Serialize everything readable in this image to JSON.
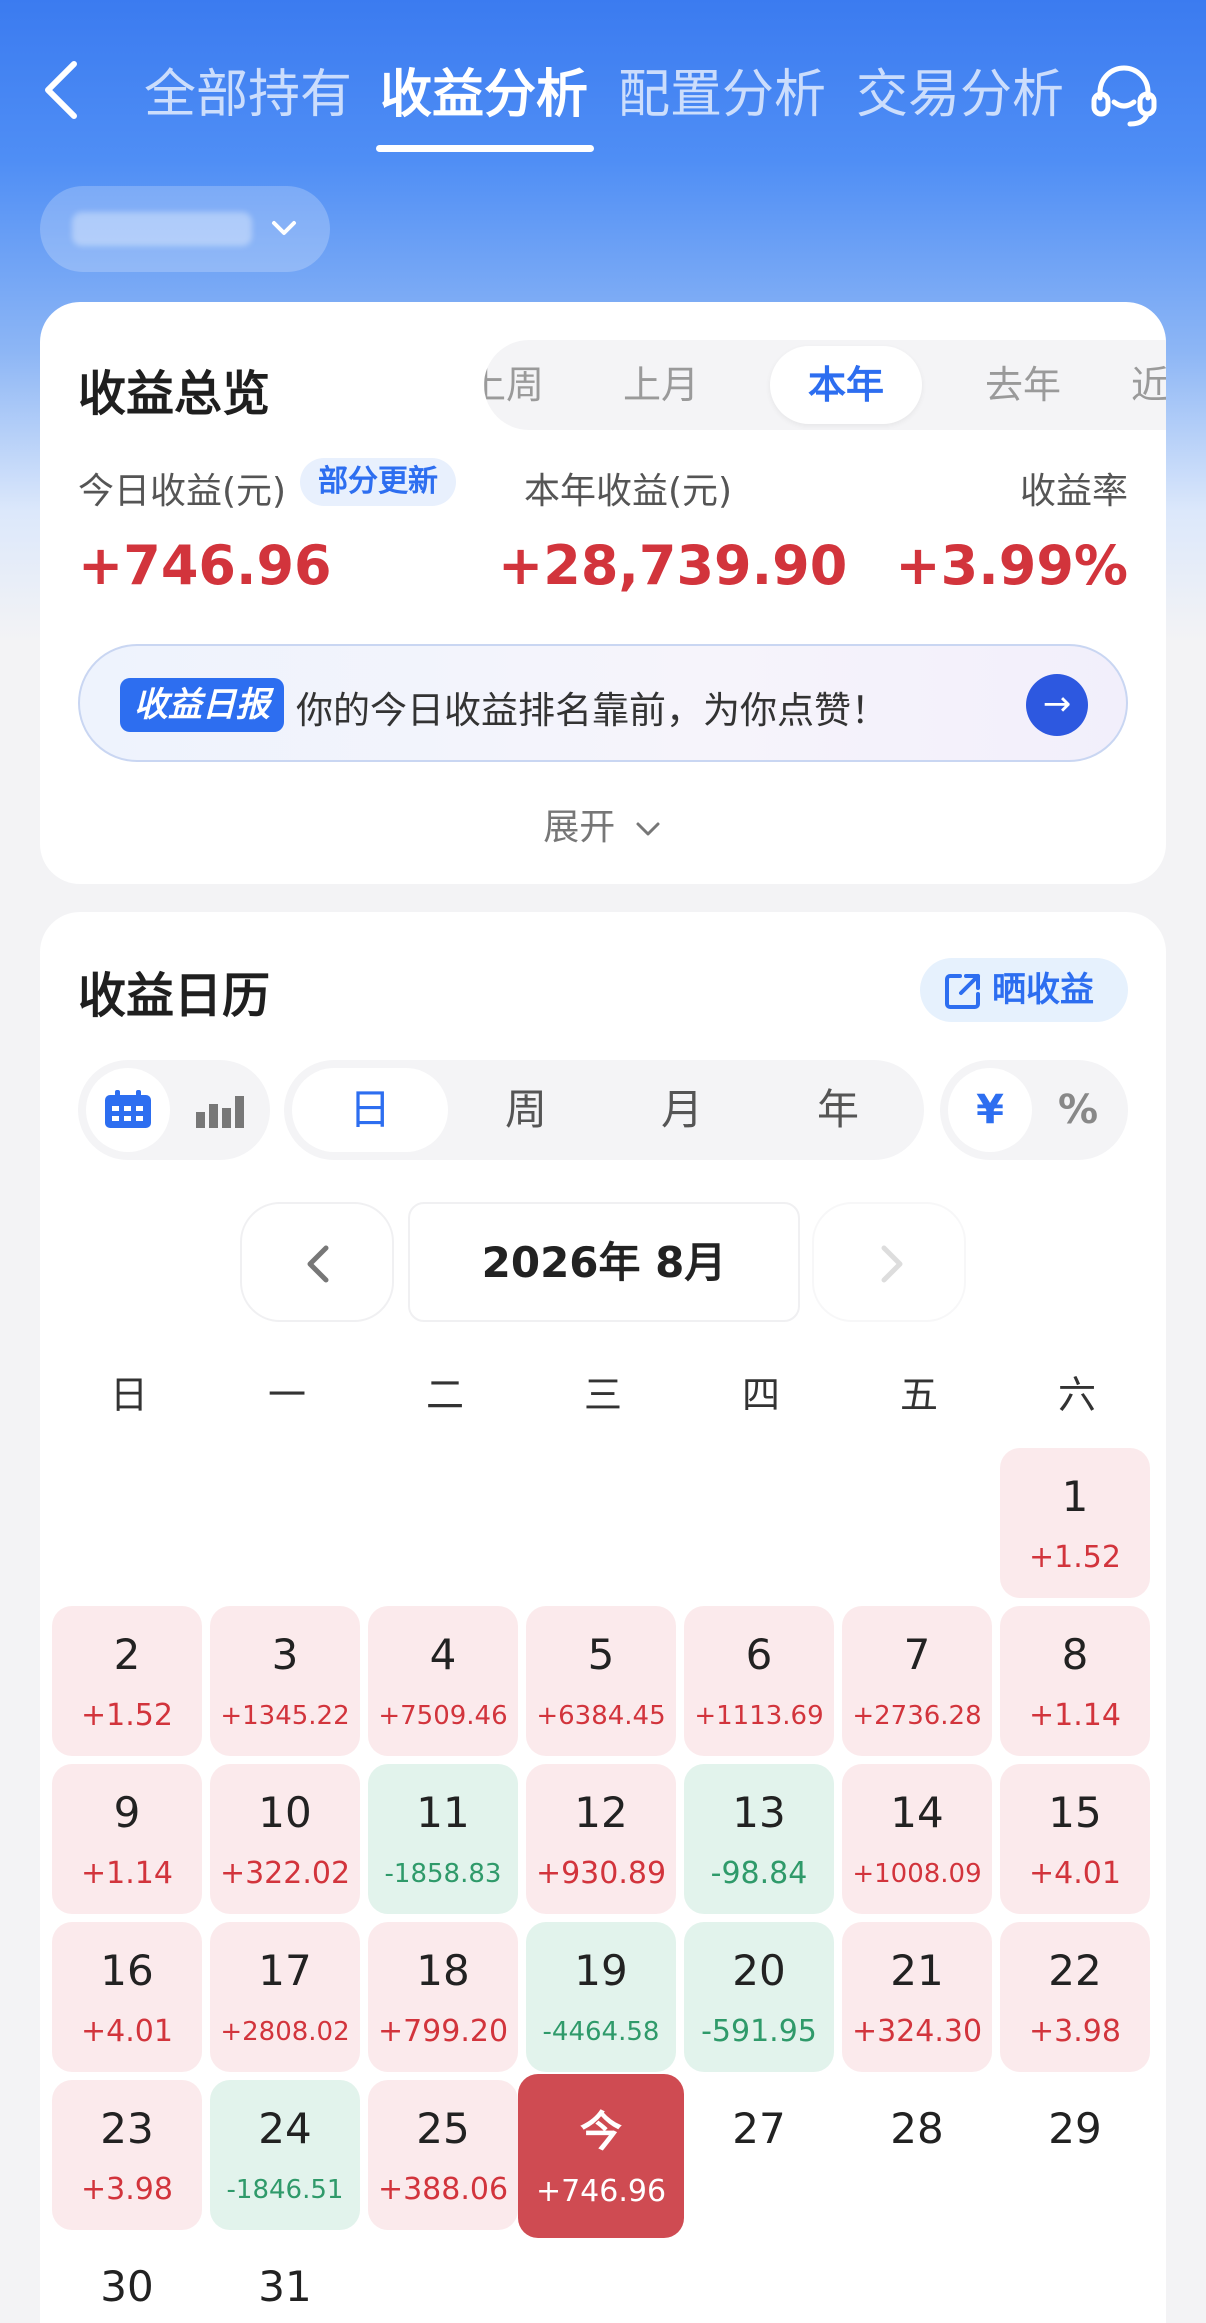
{
  "nav": {
    "tabs": [
      "全部持有",
      "收益分析",
      "配置分析",
      "交易分析"
    ],
    "active_tab": "收益分析"
  },
  "overview": {
    "title": "收益总览",
    "periods": [
      "上周",
      "上月",
      "本年",
      "去年",
      "近一"
    ],
    "active_period": "本年",
    "today_label": "今日收益(元)",
    "update_badge": "部分更新",
    "today_value": "+746.96",
    "year_label": "本年收益(元)",
    "year_value": "+28,739.90",
    "rate_label": "收益率",
    "rate_value": "+3.99%",
    "report_tag": "收益日报",
    "report_text": "你的今日收益排名靠前，为你点赞！",
    "expand_label": "展开"
  },
  "calendar": {
    "title": "收益日历",
    "share_label": "晒收益",
    "granularity": [
      "日",
      "周",
      "月",
      "年"
    ],
    "active_granularity": "日",
    "units": [
      "¥",
      "%"
    ],
    "active_unit": "¥",
    "month_label": "2026年 8月",
    "weekdays": [
      "日",
      "一",
      "二",
      "三",
      "四",
      "五",
      "六"
    ],
    "days": [
      {
        "d": "1",
        "v": "+1.52"
      },
      {
        "d": "2",
        "v": "+1.52"
      },
      {
        "d": "3",
        "v": "+1345.22"
      },
      {
        "d": "4",
        "v": "+7509.46"
      },
      {
        "d": "5",
        "v": "+6384.45"
      },
      {
        "d": "6",
        "v": "+1113.69"
      },
      {
        "d": "7",
        "v": "+2736.28"
      },
      {
        "d": "8",
        "v": "+1.14"
      },
      {
        "d": "9",
        "v": "+1.14"
      },
      {
        "d": "10",
        "v": "+322.02"
      },
      {
        "d": "11",
        "v": "-1858.83"
      },
      {
        "d": "12",
        "v": "+930.89"
      },
      {
        "d": "13",
        "v": "-98.84"
      },
      {
        "d": "14",
        "v": "+1008.09"
      },
      {
        "d": "15",
        "v": "+4.01"
      },
      {
        "d": "16",
        "v": "+4.01"
      },
      {
        "d": "17",
        "v": "+2808.02"
      },
      {
        "d": "18",
        "v": "+799.20"
      },
      {
        "d": "19",
        "v": "-4464.58"
      },
      {
        "d": "20",
        "v": "-591.95"
      },
      {
        "d": "21",
        "v": "+324.30"
      },
      {
        "d": "22",
        "v": "+3.98"
      },
      {
        "d": "23",
        "v": "+3.98"
      },
      {
        "d": "24",
        "v": "-1846.51"
      },
      {
        "d": "25",
        "v": "+388.06"
      },
      {
        "d": "今",
        "v": "+746.96",
        "today": true
      },
      {
        "d": "27",
        "v": ""
      },
      {
        "d": "28",
        "v": ""
      },
      {
        "d": "29",
        "v": ""
      },
      {
        "d": "30",
        "v": ""
      },
      {
        "d": "31",
        "v": ""
      }
    ]
  },
  "colors": {
    "brand_blue": "#2d6ef0",
    "gain_red": "#d2343c",
    "loss_green": "#2f9a6a",
    "today_bg": "#cf4b52"
  }
}
